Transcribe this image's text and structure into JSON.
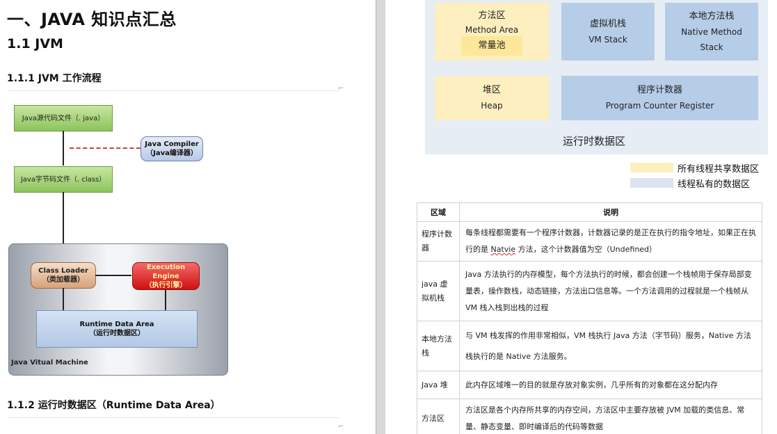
{
  "left": {
    "h1": "一、JAVA 知识点汇总",
    "h2": "1.1 JVM",
    "h3_flow": "1.1.1 JVM  工作流程",
    "h3_runtime": "1.1.2  运行时数据区（Runtime Data Area）",
    "flow": {
      "source": "Java源代码文件（. java）",
      "compiler": "Java Compiler\n（Java编译器）",
      "bytecode": "Java字节码文件（. class）",
      "classloader": "Class Loader\n（类加载器）",
      "engine": "Execution Engine\n（执行引擎）",
      "runtime": "Runtime  Data  Area\n（运行时数据区）",
      "jvm": "Java Vitual Machine"
    }
  },
  "right": {
    "diagram": {
      "method_area": "方法区",
      "method_area_en": "Method Area",
      "const_pool": "常量池",
      "vm_stack": "虚拟机栈",
      "vm_stack_en": "VM Stack",
      "native_stack": "本地方法栈",
      "native_stack_en": "Native Method\nStack",
      "heap": "堆区",
      "heap_en": "Heap",
      "pc": "程序计数器",
      "pc_en": "Program Counter Register",
      "caption": "运行时数据区"
    },
    "legend": {
      "shared": "所有线程共享数据区",
      "private": "线程私有的数据区",
      "shared_color": "#fdefc0",
      "private_color": "#dde3f0"
    },
    "table": {
      "headers": [
        "区域",
        "说明"
      ],
      "rows": [
        {
          "region": "程序计数器",
          "desc_a": "每条线程都需要有一个程序计数器，计数器记录的是正在执行的指令地址，如果正在执行的是 ",
          "desc_b": "Natvie",
          "desc_c": " 方法，这个计数器值为空（Undefined）"
        },
        {
          "region": "java 虚拟机栈",
          "desc_a": "Java 方法执行的内存模型，每个方法执行的时候，都会创建一个栈帧用于保存局部变量表，操作数栈，动态链接，方法出口信息等。一个方法调用的过程就是一个栈帧从 VM 栈入栈到出栈的过程",
          "desc_b": "",
          "desc_c": ""
        },
        {
          "region": "本地方法栈",
          "desc_a": "与  VM  栈发挥的作用非常相似，VM  栈执行  Java 方法（字节码）服务，Native 方法栈执行的是  Native  方法服务。",
          "desc_b": "",
          "desc_c": ""
        },
        {
          "region": "Java 堆",
          "desc_a": "此内存区域唯一的目的就是存放对象实例，几乎所有的对象都在这分配内存",
          "desc_b": "",
          "desc_c": ""
        },
        {
          "region": "方法区",
          "desc_a": "方法区是各个内存所共享的内存空间，方法区中主要存放被  JVM  加载的类信息、常量、静态变量、即时编译后的代码等数据",
          "desc_b": "",
          "desc_c": ""
        }
      ]
    }
  }
}
